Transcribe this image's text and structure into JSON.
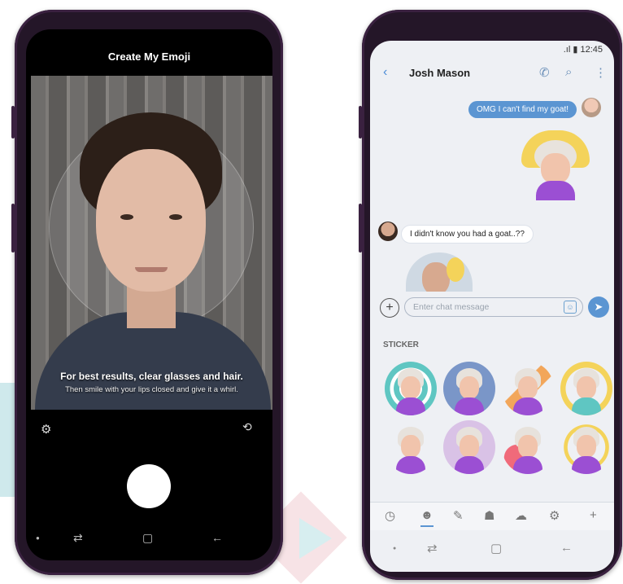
{
  "left_screen": {
    "title": "Create My Emoji",
    "hint_primary": "For best results, clear glasses and hair.",
    "hint_secondary": "Then smile with your lips closed and give it a whirl.",
    "icons": [
      "settings-gear",
      "flip-camera",
      "shutter"
    ]
  },
  "right_screen": {
    "status_time": "12:45",
    "contact_name": "Josh Mason",
    "messages": [
      {
        "direction": "out",
        "text": "OMG I can't find my goat!"
      },
      {
        "direction": "in",
        "text": "I didn't know you had a goat..??"
      }
    ],
    "input_placeholder": "Enter chat message",
    "sticker_section_label": "STICKER",
    "header_icons": [
      "back-arrow",
      "phone",
      "search",
      "more-vertical"
    ]
  },
  "colors": {
    "accent": "#5b95d2",
    "phone_body": "#241628"
  }
}
